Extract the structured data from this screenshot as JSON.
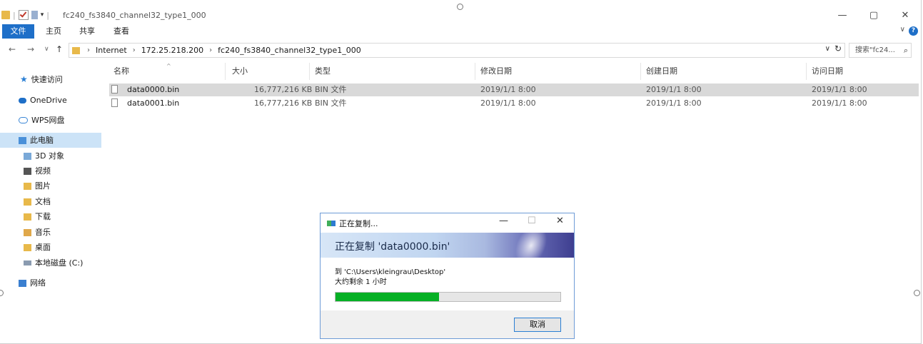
{
  "window": {
    "title": "fc240_fs3840_channel32_type1_000",
    "qat_sep": "|",
    "qat_dropdown": "▾",
    "controls": {
      "minimize": "—",
      "maximize": "▢",
      "close": "✕"
    }
  },
  "ribbon": {
    "tabs": [
      "文件",
      "主页",
      "共享",
      "查看"
    ],
    "expand": "∨",
    "help": "?"
  },
  "nav": {
    "back": "←",
    "forward": "→",
    "recent": "∨",
    "up": "↑",
    "breadcrumb": [
      "Internet",
      "172.25.218.200",
      "fc240_fs3840_channel32_type1_000"
    ],
    "crumb_sep": "›",
    "dropdown": "∨",
    "refresh": "↻",
    "search_placeholder": "搜索\"fc24...",
    "search_icon": "⌕"
  },
  "sidebar": {
    "items": [
      {
        "label": "快速访问",
        "icon": "star-icon"
      },
      {
        "label": "OneDrive",
        "icon": "cloud-icon"
      },
      {
        "label": "WPS网盘",
        "icon": "wps-cloud-icon"
      },
      {
        "label": "此电脑",
        "icon": "computer-icon",
        "selected": true
      },
      {
        "label": "3D 对象",
        "icon": "3d-objects-icon"
      },
      {
        "label": "视频",
        "icon": "video-folder-icon"
      },
      {
        "label": "图片",
        "icon": "pictures-folder-icon"
      },
      {
        "label": "文档",
        "icon": "documents-folder-icon"
      },
      {
        "label": "下载",
        "icon": "downloads-folder-icon"
      },
      {
        "label": "音乐",
        "icon": "music-folder-icon"
      },
      {
        "label": "桌面",
        "icon": "desktop-folder-icon"
      },
      {
        "label": "本地磁盘 (C:)",
        "icon": "drive-icon"
      },
      {
        "label": "网络",
        "icon": "network-icon"
      }
    ]
  },
  "file_list": {
    "sort_caret": "^",
    "columns": [
      "名称",
      "大小",
      "类型",
      "修改日期",
      "创建日期",
      "访问日期"
    ],
    "rows": [
      {
        "name": "data0000.bin",
        "size": "16,777,216 KB",
        "type": "BIN 文件",
        "modified": "2019/1/1 8:00",
        "created": "2019/1/1 8:00",
        "accessed": "2019/1/1 8:00",
        "selected": true
      },
      {
        "name": "data0001.bin",
        "size": "16,777,216 KB",
        "type": "BIN 文件",
        "modified": "2019/1/1 8:00",
        "created": "2019/1/1 8:00",
        "accessed": "2019/1/1 8:00",
        "selected": false
      }
    ]
  },
  "copy_dialog": {
    "title": "正在复制...",
    "controls": {
      "minimize": "—",
      "maximize": "☐",
      "close": "✕"
    },
    "heading": "正在复制 'data0000.bin'",
    "destination": "到 'C:\\Users\\kleingrau\\Desktop'",
    "remaining": "大约剩余 1 小时",
    "progress": 0.46,
    "cancel_label": "取消",
    "progress_color": "#06b025"
  },
  "colors": {
    "accent": "#1e6fc8",
    "selection": "#d9d9d9",
    "nav_selection": "#cce3f7"
  }
}
